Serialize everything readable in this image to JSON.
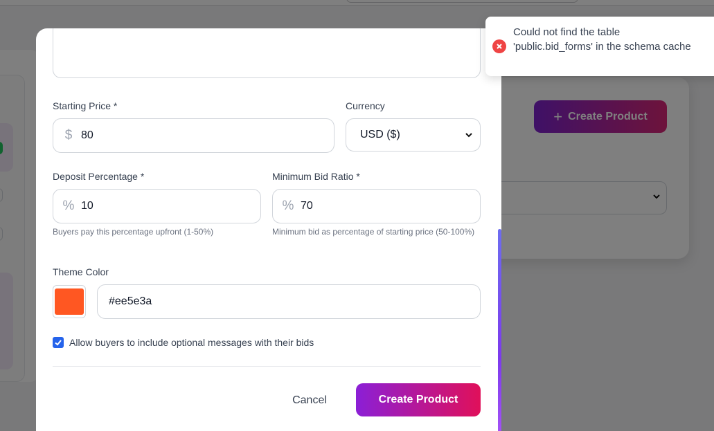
{
  "background": {
    "create_product_label": "Create Product"
  },
  "modal": {
    "starting_price": {
      "label": "Starting Price *",
      "prefix": "$",
      "value": "80"
    },
    "currency": {
      "label": "Currency",
      "selected": "USD ($)"
    },
    "deposit": {
      "label": "Deposit Percentage *",
      "prefix": "%",
      "value": "10",
      "hint": "Buyers pay this percentage upfront (1-50%)"
    },
    "min_bid": {
      "label": "Minimum Bid Ratio *",
      "prefix": "%",
      "value": "70",
      "hint": "Minimum bid as percentage of starting price (50-100%)"
    },
    "theme": {
      "label": "Theme Color",
      "value": "#ee5e3a",
      "swatch_color": "#ff5722"
    },
    "allow_messages": {
      "label": "Allow buyers to include optional messages with their bids",
      "checked": true
    },
    "cancel_label": "Cancel",
    "create_label": "Create Product"
  },
  "toast": {
    "message": "Could not find the table 'public.bid_forms' in the schema cache",
    "icon": "error-icon"
  },
  "colors": {
    "accent_start": "#8b1fd6",
    "accent_end": "#e0105a",
    "error": "#ef4444",
    "checkbox": "#2563eb"
  }
}
